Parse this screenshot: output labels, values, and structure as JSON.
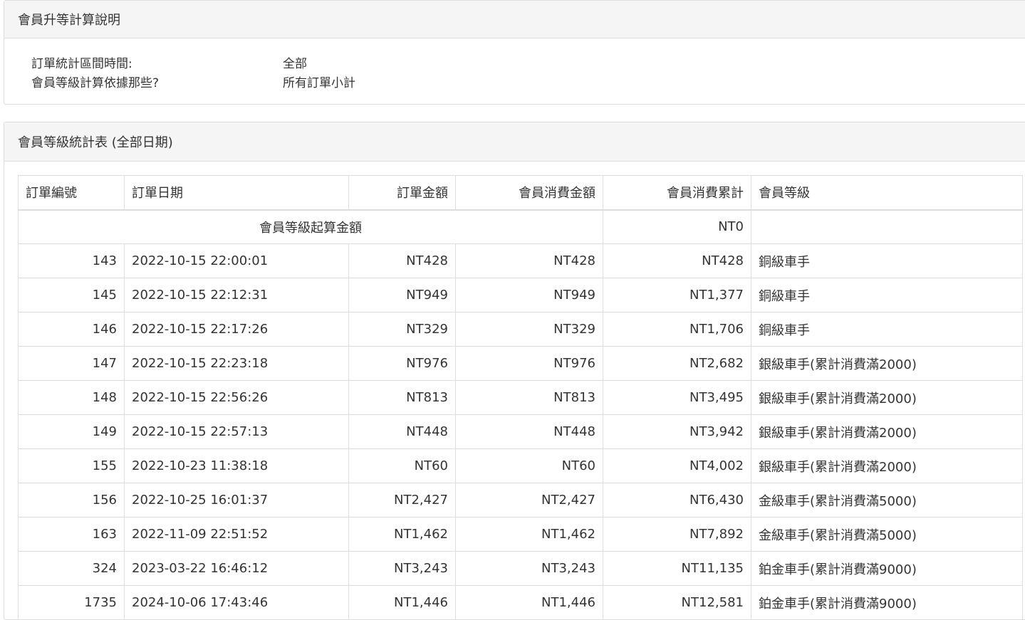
{
  "rules_panel": {
    "title": "會員升等計算說明",
    "rows": [
      {
        "label": "訂單統計區間時間:",
        "value": "全部"
      },
      {
        "label": "會員等級計算依據那些?",
        "value": "所有訂單小計"
      }
    ]
  },
  "stats_panel": {
    "title": "會員等級統計表 (全部日期)",
    "headers": {
      "order_no": "訂單編號",
      "order_date": "訂單日期",
      "order_amount": "訂單金額",
      "member_spend": "會員消費金額",
      "member_cumulative": "會員消費累計",
      "member_level": "會員等級"
    },
    "start_row": {
      "label": "會員等級起算金額",
      "cumulative": "NT0"
    },
    "rows": [
      {
        "id": "143",
        "date": "2022-10-15 22:00:01",
        "amount": "NT428",
        "spend": "NT428",
        "cumulative": "NT428",
        "level": "銅級車手"
      },
      {
        "id": "145",
        "date": "2022-10-15 22:12:31",
        "amount": "NT949",
        "spend": "NT949",
        "cumulative": "NT1,377",
        "level": "銅級車手"
      },
      {
        "id": "146",
        "date": "2022-10-15 22:17:26",
        "amount": "NT329",
        "spend": "NT329",
        "cumulative": "NT1,706",
        "level": "銅級車手"
      },
      {
        "id": "147",
        "date": "2022-10-15 22:23:18",
        "amount": "NT976",
        "spend": "NT976",
        "cumulative": "NT2,682",
        "level": "銀級車手(累計消費滿2000)"
      },
      {
        "id": "148",
        "date": "2022-10-15 22:56:26",
        "amount": "NT813",
        "spend": "NT813",
        "cumulative": "NT3,495",
        "level": "銀級車手(累計消費滿2000)"
      },
      {
        "id": "149",
        "date": "2022-10-15 22:57:13",
        "amount": "NT448",
        "spend": "NT448",
        "cumulative": "NT3,942",
        "level": "銀級車手(累計消費滿2000)"
      },
      {
        "id": "155",
        "date": "2022-10-23 11:38:18",
        "amount": "NT60",
        "spend": "NT60",
        "cumulative": "NT4,002",
        "level": "銀級車手(累計消費滿2000)"
      },
      {
        "id": "156",
        "date": "2022-10-25 16:01:37",
        "amount": "NT2,427",
        "spend": "NT2,427",
        "cumulative": "NT6,430",
        "level": "金級車手(累計消費滿5000)"
      },
      {
        "id": "163",
        "date": "2022-11-09 22:51:52",
        "amount": "NT1,462",
        "spend": "NT1,462",
        "cumulative": "NT7,892",
        "level": "金級車手(累計消費滿5000)"
      },
      {
        "id": "324",
        "date": "2023-03-22 16:46:12",
        "amount": "NT3,243",
        "spend": "NT3,243",
        "cumulative": "NT11,135",
        "level": "鉑金車手(累計消費滿9000)"
      },
      {
        "id": "1735",
        "date": "2024-10-06 17:43:46",
        "amount": "NT1,446",
        "spend": "NT1,446",
        "cumulative": "NT12,581",
        "level": "鉑金車手(累計消費滿9000)"
      }
    ]
  }
}
